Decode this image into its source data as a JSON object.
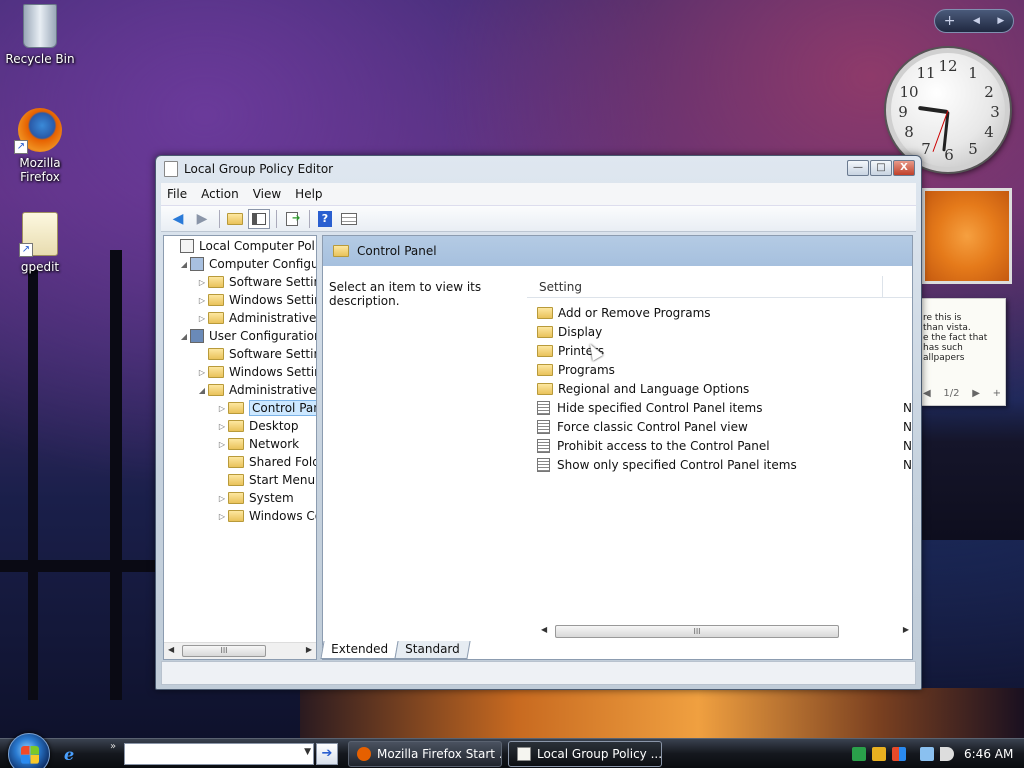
{
  "desktop": {
    "icons": [
      {
        "label": "Recycle Bin"
      },
      {
        "label": "Mozilla Firefox"
      },
      {
        "label": "gpedit"
      }
    ]
  },
  "gadgets": {
    "sidebar_controls": {
      "add": "+",
      "prev": "◀",
      "next": "▶"
    },
    "clock": {
      "numbers": [
        "12",
        "1",
        "2",
        "3",
        "4",
        "5",
        "6",
        "7",
        "8",
        "9",
        "10",
        "11"
      ],
      "time": "6:46"
    },
    "notes": {
      "lines": [
        "re this is",
        "than vista.",
        "e the fact that",
        "has such",
        "allpapers"
      ],
      "page": "1/2",
      "prev": "◀",
      "next": "▶",
      "add": "+"
    }
  },
  "window": {
    "title": "Local Group Policy Editor",
    "controls": {
      "minimize": "—",
      "maximize": "□",
      "close": "X"
    },
    "menu": [
      "File",
      "Action",
      "View",
      "Help"
    ],
    "toolbar_icons": [
      "back-icon",
      "forward-icon",
      "up-folder-icon",
      "show-hide-tree-icon",
      "export-list-icon",
      "help-icon",
      "properties-icon"
    ],
    "tree": [
      {
        "label": "Local Computer Policy",
        "level": 0,
        "expander": "",
        "icon": "computer-policy-icon"
      },
      {
        "label": "Computer Configura",
        "level": 1,
        "expander": "◢",
        "icon": "computer-icon"
      },
      {
        "label": "Software Settings",
        "level": 2,
        "expander": "▷",
        "icon": "folder-icon"
      },
      {
        "label": "Windows Setting",
        "level": 2,
        "expander": "▷",
        "icon": "folder-icon"
      },
      {
        "label": "Administrative Te",
        "level": 2,
        "expander": "▷",
        "icon": "folder-icon"
      },
      {
        "label": "User Configuration",
        "level": 1,
        "expander": "◢",
        "icon": "user-icon"
      },
      {
        "label": "Software Settings",
        "level": 2,
        "expander": "",
        "icon": "folder-icon"
      },
      {
        "label": "Windows Setting",
        "level": 2,
        "expander": "▷",
        "icon": "folder-icon"
      },
      {
        "label": "Administrative Te",
        "level": 2,
        "expander": "◢",
        "icon": "folder-icon"
      },
      {
        "label": "Control Panel",
        "level": 3,
        "expander": "▷",
        "icon": "folder-icon",
        "selected": true
      },
      {
        "label": "Desktop",
        "level": 3,
        "expander": "▷",
        "icon": "folder-icon"
      },
      {
        "label": "Network",
        "level": 3,
        "expander": "▷",
        "icon": "folder-icon"
      },
      {
        "label": "Shared Folder",
        "level": 3,
        "expander": "",
        "icon": "folder-icon"
      },
      {
        "label": "Start Menu ar",
        "level": 3,
        "expander": "",
        "icon": "folder-icon"
      },
      {
        "label": "System",
        "level": 3,
        "expander": "▷",
        "icon": "folder-icon"
      },
      {
        "label": "Windows Cor",
        "level": 3,
        "expander": "▷",
        "icon": "folder-icon"
      }
    ],
    "right_pane": {
      "header": "Control Panel",
      "description": "Select an item to view its description.",
      "column_setting": "Setting",
      "items": [
        {
          "label": "Add or Remove Programs",
          "type": "folder",
          "state": ""
        },
        {
          "label": "Display",
          "type": "folder",
          "state": ""
        },
        {
          "label": "Printers",
          "type": "folder",
          "state": ""
        },
        {
          "label": "Programs",
          "type": "folder",
          "state": ""
        },
        {
          "label": "Regional and Language Options",
          "type": "folder",
          "state": ""
        },
        {
          "label": "Hide specified Control Panel items",
          "type": "policy",
          "state": "Not"
        },
        {
          "label": "Force classic Control Panel view",
          "type": "policy",
          "state": "Not"
        },
        {
          "label": "Prohibit access to the Control Panel",
          "type": "policy",
          "state": "Not"
        },
        {
          "label": "Show only specified Control Panel items",
          "type": "policy",
          "state": "Not"
        }
      ]
    },
    "tabs": [
      "Extended",
      "Standard"
    ],
    "scroll_thumb_glyph": "III",
    "scroll_left": "◀",
    "scroll_right": "▶"
  },
  "taskbar": {
    "ie_glyph": "e",
    "quicklaunch_more": "»",
    "address_dropdown": "▼",
    "go_arrow": "➔",
    "buttons": [
      {
        "label": "Mozilla Firefox Start ...",
        "active": false
      },
      {
        "label": "Local Group Policy ...",
        "active": true
      }
    ],
    "clock": "6:46 AM",
    "colors": {
      "firefox": "#e66000",
      "gpedit": "#f5f5f0"
    }
  }
}
